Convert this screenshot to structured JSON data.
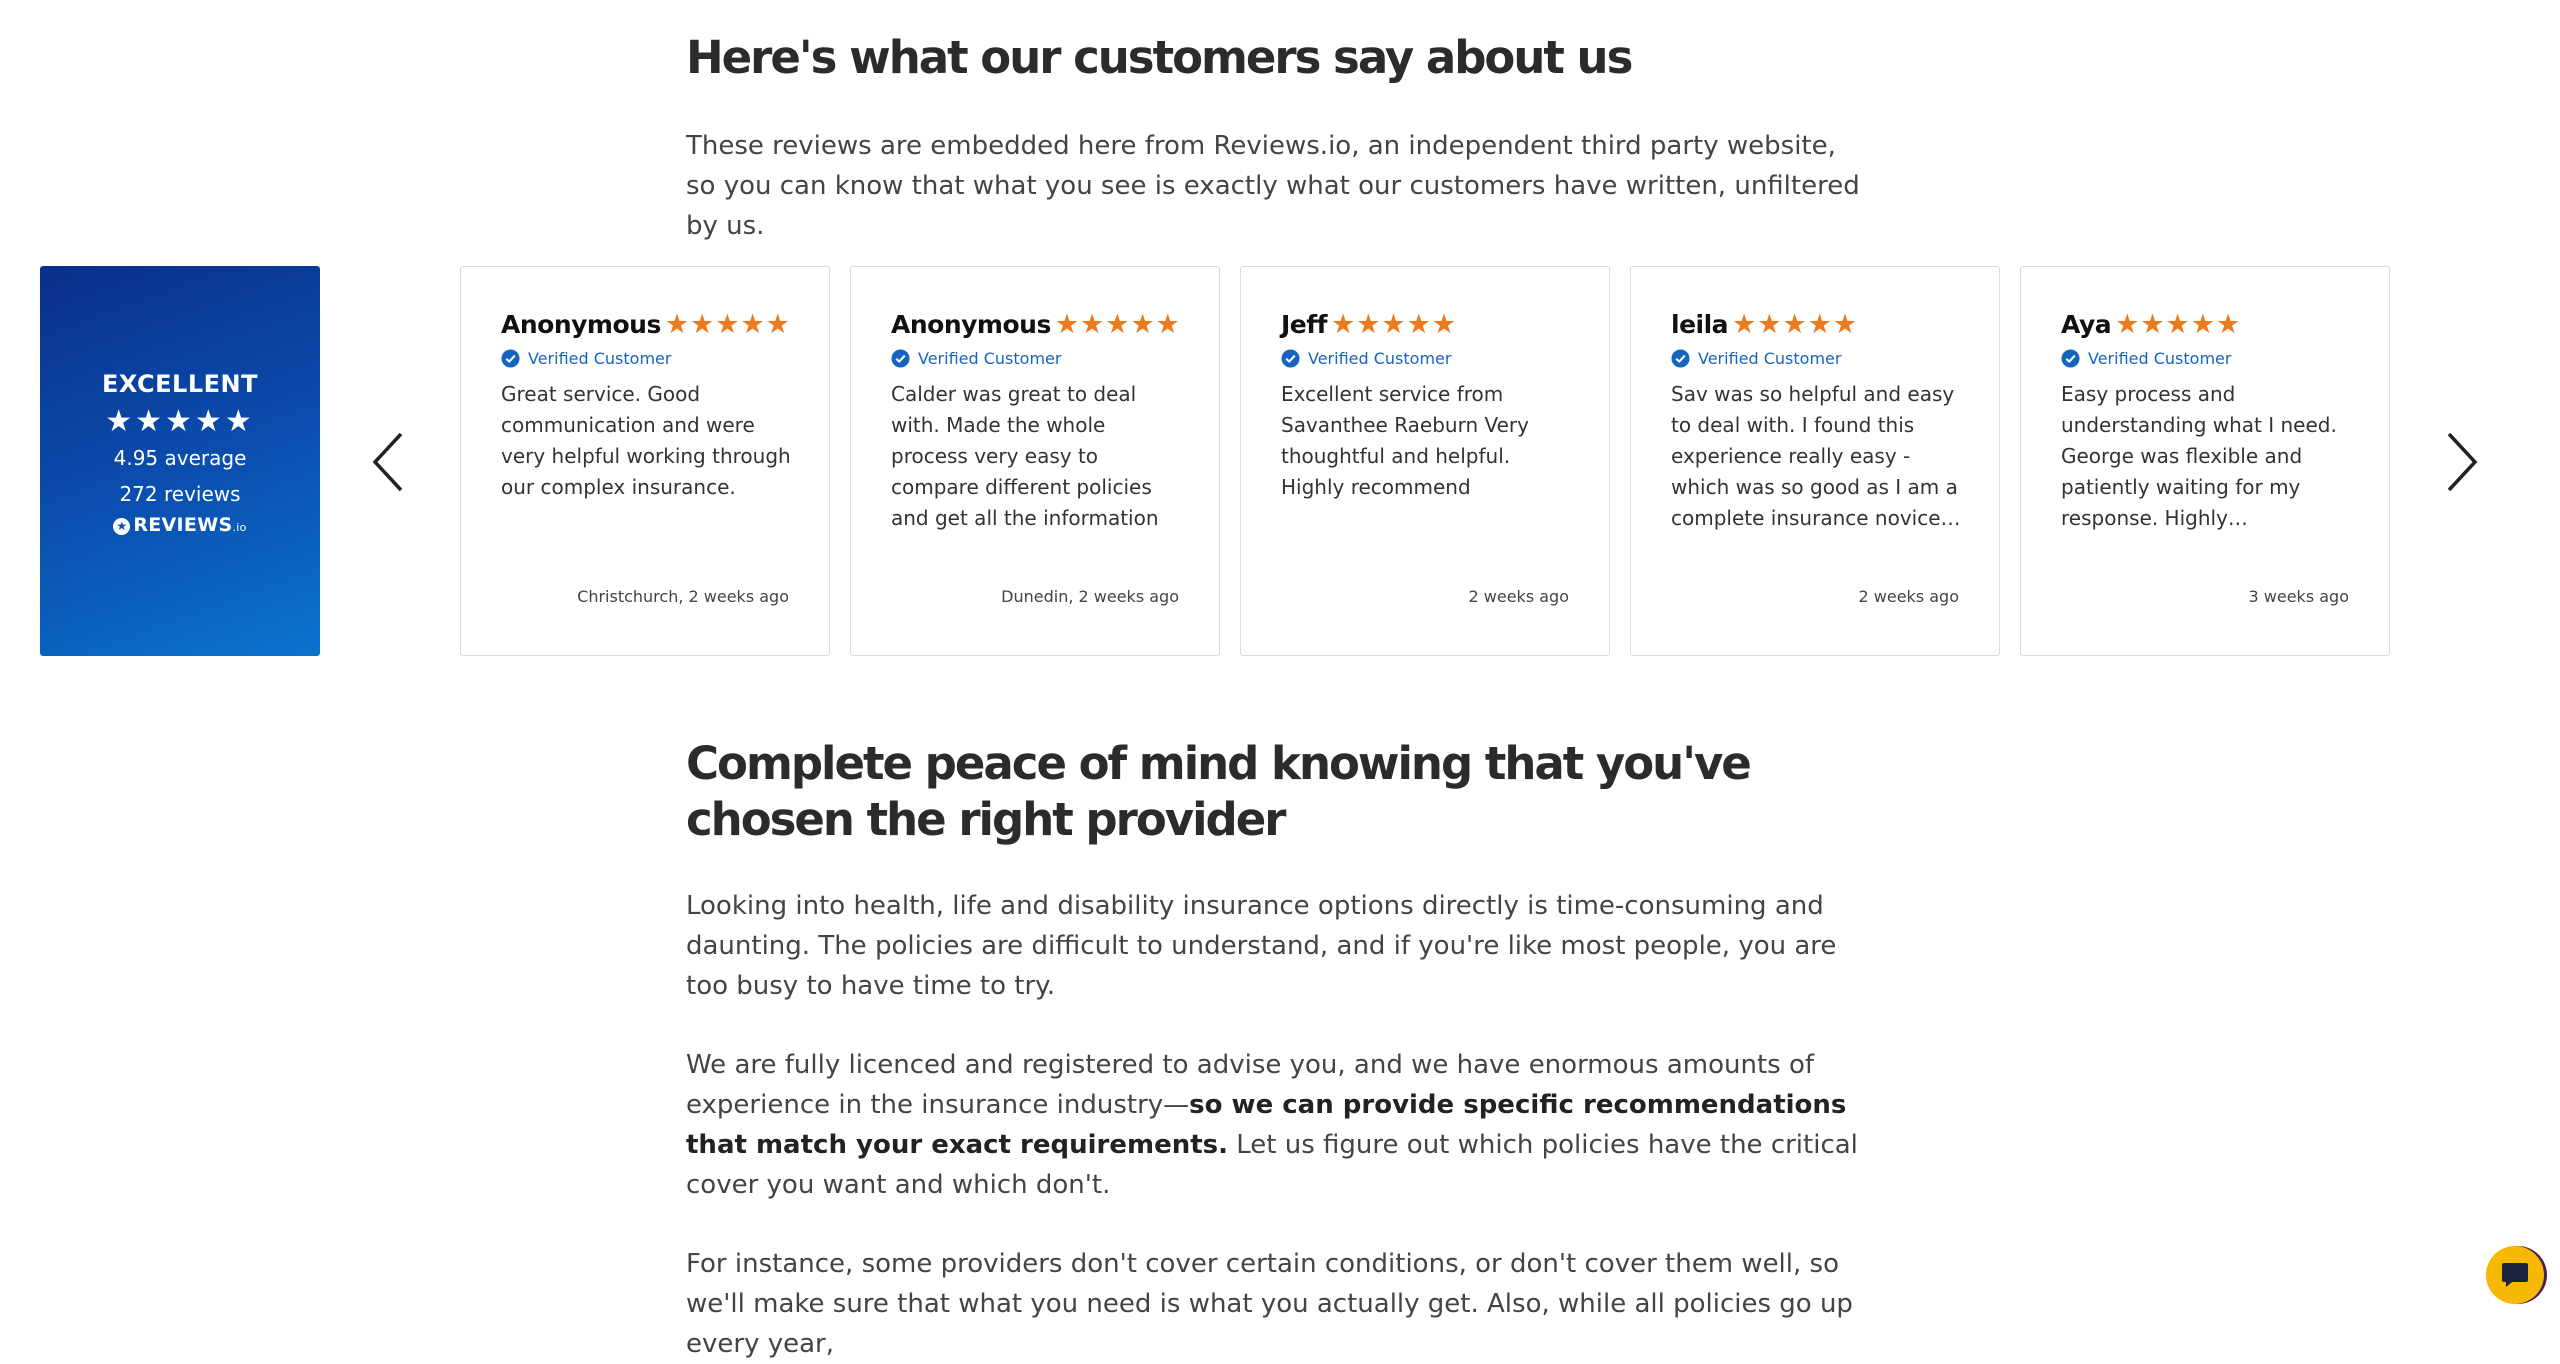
{
  "section1": {
    "heading": "Here's what our customers say about us",
    "intro": "These reviews are embedded here from Reviews.io, an independent third party website, so you can know that what you see is exactly what our customers have written, unfiltered by us."
  },
  "badge": {
    "rating_word": "EXCELLENT",
    "stars": "★★★★★",
    "average": "4.95 average",
    "count": "272 reviews",
    "brand": "REVIEWS",
    "brand_suffix": "io"
  },
  "carousel": {
    "prev_icon": "chevron-left-icon",
    "next_icon": "chevron-right-icon",
    "star_color": "#ee7a1b",
    "verified_label": "Verified Customer",
    "reviews": [
      {
        "name": "Anonymous",
        "stars": "★★★★★",
        "text": "Great service. Good communication and were very helpful working through our complex insurance.",
        "meta": "Christchurch, 2 weeks ago"
      },
      {
        "name": "Anonymous",
        "stars": "★★★★★",
        "text": "Calder was great to deal with. Made the whole process very easy to compare different policies and get all the information together. Thank…",
        "meta": "Dunedin, 2 weeks ago"
      },
      {
        "name": "Jeff",
        "stars": "★★★★★",
        "text": "Excellent service from Savanthee Raeburn Very thoughtful and helpful. Highly recommend",
        "meta": "2 weeks ago"
      },
      {
        "name": "leila",
        "stars": "★★★★★",
        "text": "Sav was so helpful and easy to deal with. I found this experience really easy - which was so good as I am a complete insurance novice…",
        "meta": "2 weeks ago"
      },
      {
        "name": "Aya",
        "stars": "★★★★★",
        "text": "Easy process and understanding what I need. George was flexible and patiently waiting for my response. Highly…",
        "meta": "3 weeks ago"
      }
    ]
  },
  "section2": {
    "heading": "Complete peace of mind knowing that you've chosen the right provider",
    "p1": "Looking into health, life and disability insurance options directly is time-consuming and daunting. The policies are difficult to understand, and if you're like most people, you are too busy to have time to try.",
    "p2_before": "We are fully licenced and registered to advise you, and we have enormous amounts of experience in the insurance industry—",
    "p2_bold": "so we can provide specific recommendations that match your exact requirements.",
    "p2_after": " Let us figure out which policies have the critical cover you want and which don't.",
    "p3": "For instance, some providers don't cover certain conditions, or don't cover them well, so we'll make sure that what you need is what you actually get. Also, while all policies go up every year,"
  },
  "chat": {
    "icon": "chat-bubble-icon",
    "color": "#f6b800"
  }
}
